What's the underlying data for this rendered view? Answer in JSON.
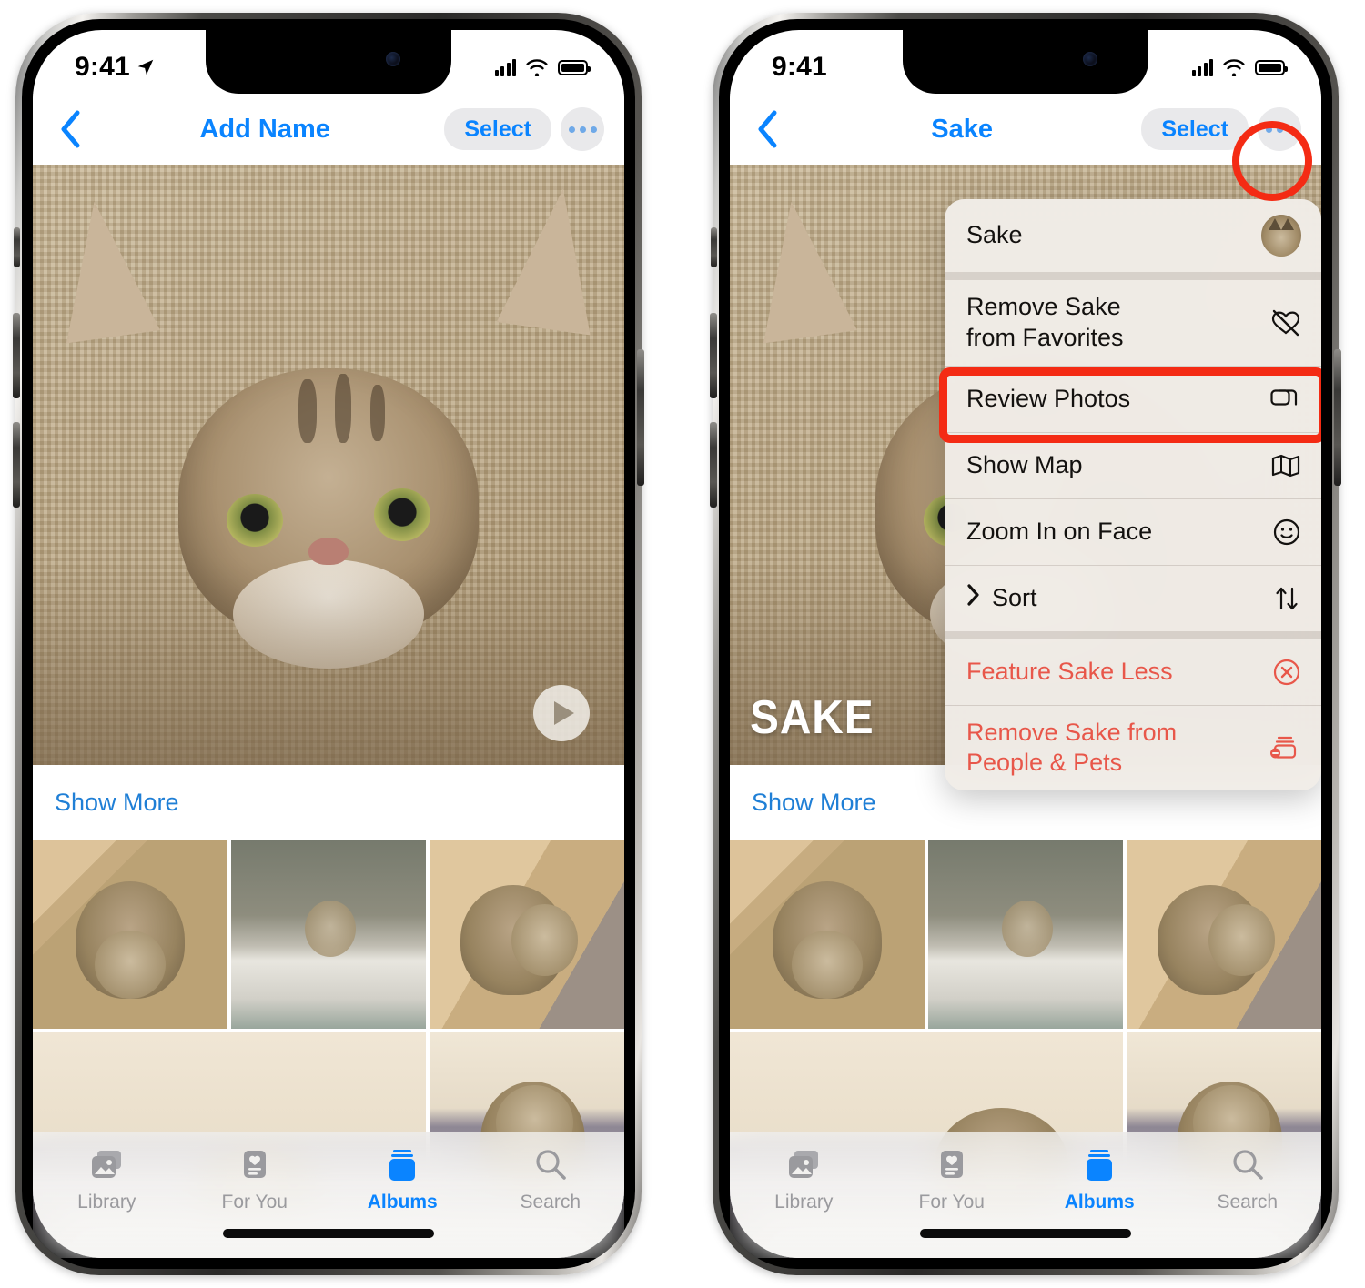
{
  "meta": {
    "accent_blue": "#0a84ff",
    "link_blue": "#1f7fd6",
    "highlight_red": "#f42b14",
    "danger_red": "#e8574a"
  },
  "phones": [
    {
      "id": "left",
      "status": {
        "time": "9:41",
        "location_arrow": "location-arrow-icon",
        "signal": "cellular-bars-icon",
        "wifi": "wifi-icon",
        "battery": "battery-full-icon"
      },
      "navbar": {
        "back": "chevron-left-icon",
        "title": "Add Name",
        "select_label": "Select",
        "more": "ellipsis-icon"
      },
      "hero": {
        "play_badge": "play-icon",
        "name_overlay": ""
      },
      "show_more_label": "Show More",
      "tabs": [
        {
          "label": "Library",
          "icon": "photos-library-icon",
          "active": false
        },
        {
          "label": "For You",
          "icon": "for-you-icon",
          "active": false
        },
        {
          "label": "Albums",
          "icon": "albums-icon",
          "active": true
        },
        {
          "label": "Search",
          "icon": "search-icon",
          "active": false
        }
      ],
      "menu_open": false
    },
    {
      "id": "right",
      "status": {
        "time": "9:41",
        "location_arrow": "",
        "signal": "cellular-bars-icon",
        "wifi": "wifi-icon",
        "battery": "battery-full-icon"
      },
      "navbar": {
        "back": "chevron-left-icon",
        "title": "Sake",
        "select_label": "Select",
        "more": "ellipsis-icon"
      },
      "hero": {
        "play_badge": "",
        "name_overlay": "SAKE"
      },
      "show_more_label": "Show More",
      "tabs": [
        {
          "label": "Library",
          "icon": "photos-library-icon",
          "active": false
        },
        {
          "label": "For You",
          "icon": "for-you-icon",
          "active": false
        },
        {
          "label": "Albums",
          "icon": "albums-icon",
          "active": true
        },
        {
          "label": "Search",
          "icon": "search-icon",
          "active": false
        }
      ],
      "menu_open": true
    }
  ],
  "context_menu": {
    "header": {
      "label": "Sake",
      "avatar": "person-avatar-icon"
    },
    "items": [
      {
        "label": "Remove Sake\nfrom Favorites",
        "icon": "heart-slash-icon",
        "style": "default",
        "has_submenu": false,
        "highlighted": false
      },
      {
        "label": "Review Photos",
        "icon": "photo-stack-icon",
        "style": "default",
        "has_submenu": false,
        "highlighted": true
      },
      {
        "label": "Show Map",
        "icon": "map-icon",
        "style": "default",
        "has_submenu": false,
        "highlighted": false
      },
      {
        "label": "Zoom In on Face",
        "icon": "smiley-face-icon",
        "style": "default",
        "has_submenu": false,
        "highlighted": false
      },
      {
        "label": "Sort",
        "icon": "arrow-up-arrow-down-icon",
        "style": "default",
        "has_submenu": true,
        "highlighted": false
      },
      {
        "label": "Feature Sake Less",
        "icon": "x-circle-icon",
        "style": "danger",
        "has_submenu": false,
        "highlighted": false
      },
      {
        "label": "Remove Sake from\nPeople & Pets",
        "icon": "person-remove-icon",
        "style": "danger",
        "has_submenu": false,
        "highlighted": false
      }
    ]
  },
  "annotations": [
    {
      "type": "circle",
      "target": "more-button-right-phone"
    },
    {
      "type": "rect",
      "target": "menu-item-review-photos"
    }
  ]
}
